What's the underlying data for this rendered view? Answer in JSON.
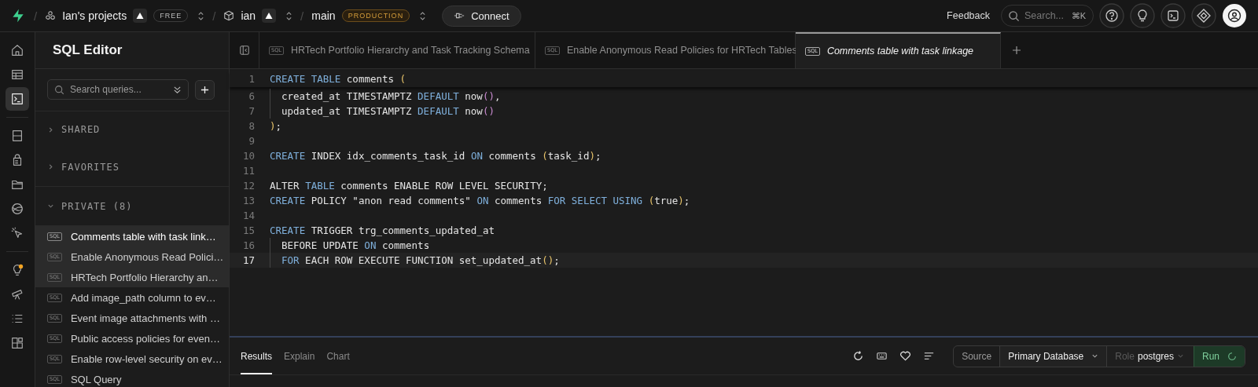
{
  "topbar": {
    "separator": "/",
    "org": {
      "name": "Ian's projects",
      "plan": "FREE"
    },
    "project": {
      "name": "ian"
    },
    "branch": {
      "name": "main",
      "env": "PRODUCTION"
    },
    "connect": "Connect",
    "feedback": "Feedback",
    "search": {
      "placeholder": "Search...",
      "shortcut": "⌘K"
    }
  },
  "rail": [
    {
      "items": [
        {
          "kind": "home",
          "selected": false
        },
        {
          "kind": "table",
          "selected": false
        },
        {
          "kind": "terminal",
          "selected": true
        }
      ]
    },
    {
      "items": [
        {
          "kind": "database",
          "selected": false
        },
        {
          "kind": "lock",
          "selected": false
        },
        {
          "kind": "folder",
          "selected": false
        },
        {
          "kind": "globe",
          "selected": false
        },
        {
          "kind": "cursor",
          "selected": false
        }
      ]
    },
    {
      "items": [
        {
          "kind": "bulb",
          "selected": false,
          "notification": true
        },
        {
          "kind": "telescope",
          "selected": false
        },
        {
          "kind": "list",
          "selected": false
        },
        {
          "kind": "blocks",
          "selected": false
        }
      ]
    }
  ],
  "sidebar": {
    "title": "SQL Editor",
    "search": {
      "placeholder": "Search queries..."
    },
    "sections": [
      {
        "label": "SHARED",
        "expanded": false
      },
      {
        "label": "FAVORITES",
        "expanded": false
      },
      {
        "label": "PRIVATE (8)",
        "expanded": true
      }
    ],
    "items": [
      {
        "tag": "SQL",
        "label": "Comments table with task link…",
        "selected": true,
        "open": true
      },
      {
        "tag": "SQL",
        "label": "Enable Anonymous Read Polici…",
        "selected": false,
        "open": true
      },
      {
        "tag": "SQL",
        "label": "HRTech Portfolio Hierarchy an…",
        "selected": false,
        "open": true
      },
      {
        "tag": "SQL",
        "label": "Add image_path column to ev…",
        "selected": false,
        "open": false
      },
      {
        "tag": "SQL",
        "label": "Event image attachments with …",
        "selected": false,
        "open": false
      },
      {
        "tag": "SQL",
        "label": "Public access policies for even…",
        "selected": false,
        "open": false
      },
      {
        "tag": "SQL",
        "label": "Enable row-level security on ev…",
        "selected": false,
        "open": false
      },
      {
        "tag": "SQL",
        "label": "SQL Query",
        "selected": false,
        "open": false
      }
    ]
  },
  "tabs": [
    {
      "tag": "SQL",
      "title": "HRTech Portfolio Hierarchy and Task Tracking Schema",
      "selected": false
    },
    {
      "tag": "SQL",
      "title": "Enable Anonymous Read Policies for HRTech Tables",
      "selected": false
    },
    {
      "tag": "SQL",
      "title": "Comments table with task linkage",
      "selected": true
    }
  ],
  "code": [
    {
      "number": "1",
      "indented": false,
      "current": false,
      "tokens": [
        {
          "text": "CREATE TABLE",
          "kind": "kw"
        },
        {
          "text": " comments ",
          "kind": "id"
        },
        {
          "text": "(",
          "kind": "paren"
        }
      ]
    },
    {
      "number": "6",
      "indented": true,
      "current": false,
      "tokens": [
        {
          "text": "created_at TIMESTAMPTZ ",
          "kind": "id"
        },
        {
          "text": "DEFAULT",
          "kind": "kw"
        },
        {
          "text": " now",
          "kind": "id"
        },
        {
          "text": "()",
          "kind": "call"
        },
        {
          "text": ",",
          "kind": "id"
        }
      ]
    },
    {
      "number": "7",
      "indented": true,
      "current": false,
      "tokens": [
        {
          "text": "updated_at TIMESTAMPTZ ",
          "kind": "id"
        },
        {
          "text": "DEFAULT",
          "kind": "kw"
        },
        {
          "text": " now",
          "kind": "id"
        },
        {
          "text": "()",
          "kind": "call"
        }
      ]
    },
    {
      "number": "8",
      "indented": false,
      "current": false,
      "tokens": [
        {
          "text": ")",
          "kind": "paren"
        },
        {
          "text": ";",
          "kind": "id"
        }
      ]
    },
    {
      "number": "9",
      "indented": false,
      "current": false
    },
    {
      "number": "10",
      "indented": false,
      "current": false,
      "tokens": [
        {
          "text": "CREATE",
          "kind": "kw"
        },
        {
          "text": " INDEX idx_comments_task_id ",
          "kind": "id"
        },
        {
          "text": "ON",
          "kind": "kw"
        },
        {
          "text": " comments ",
          "kind": "id"
        },
        {
          "text": "(",
          "kind": "paren"
        },
        {
          "text": "task_id",
          "kind": "id"
        },
        {
          "text": ")",
          "kind": "paren"
        },
        {
          "text": ";",
          "kind": "id"
        }
      ]
    },
    {
      "number": "11",
      "indented": false,
      "current": false
    },
    {
      "number": "12",
      "indented": false,
      "current": false,
      "tokens": [
        {
          "text": "ALTER ",
          "kind": "id"
        },
        {
          "text": "TABLE",
          "kind": "kw"
        },
        {
          "text": " comments ENABLE ROW LEVEL SECURITY;",
          "kind": "id"
        }
      ]
    },
    {
      "number": "13",
      "indented": false,
      "current": false,
      "tokens": [
        {
          "text": "CREATE",
          "kind": "kw"
        },
        {
          "text": " POLICY \"anon read comments\" ",
          "kind": "id"
        },
        {
          "text": "ON",
          "kind": "kw"
        },
        {
          "text": " comments ",
          "kind": "id"
        },
        {
          "text": "FOR SELECT USING ",
          "kind": "kw"
        },
        {
          "text": "(",
          "kind": "paren"
        },
        {
          "text": "true",
          "kind": "id"
        },
        {
          "text": ")",
          "kind": "paren"
        },
        {
          "text": ";",
          "kind": "id"
        }
      ]
    },
    {
      "number": "14",
      "indented": false,
      "current": false
    },
    {
      "number": "15",
      "indented": false,
      "current": false,
      "tokens": [
        {
          "text": "CREATE",
          "kind": "kw"
        },
        {
          "text": " TRIGGER trg_comments_updated_at",
          "kind": "id"
        }
      ]
    },
    {
      "number": "16",
      "indented": true,
      "current": false,
      "tokens": [
        {
          "text": "BEFORE UPDATE ",
          "kind": "id"
        },
        {
          "text": "ON",
          "kind": "kw"
        },
        {
          "text": " comments",
          "kind": "id"
        }
      ]
    },
    {
      "number": "17",
      "indented": true,
      "current": true,
      "tokens": [
        {
          "text": "FOR",
          "kind": "kw"
        },
        {
          "text": " EACH ROW EXECUTE FUNCTION set_updated_at",
          "kind": "id"
        },
        {
          "text": "()",
          "kind": "paren"
        },
        {
          "text": ";",
          "kind": "id"
        }
      ]
    }
  ],
  "results": {
    "tabs": [
      {
        "label": "Results",
        "selected": true
      },
      {
        "label": "Explain",
        "selected": false
      },
      {
        "label": "Chart",
        "selected": false
      }
    ],
    "source_label": "Source",
    "database": "Primary Database",
    "role_label": "Role",
    "role": "postgres",
    "run": "Run"
  }
}
